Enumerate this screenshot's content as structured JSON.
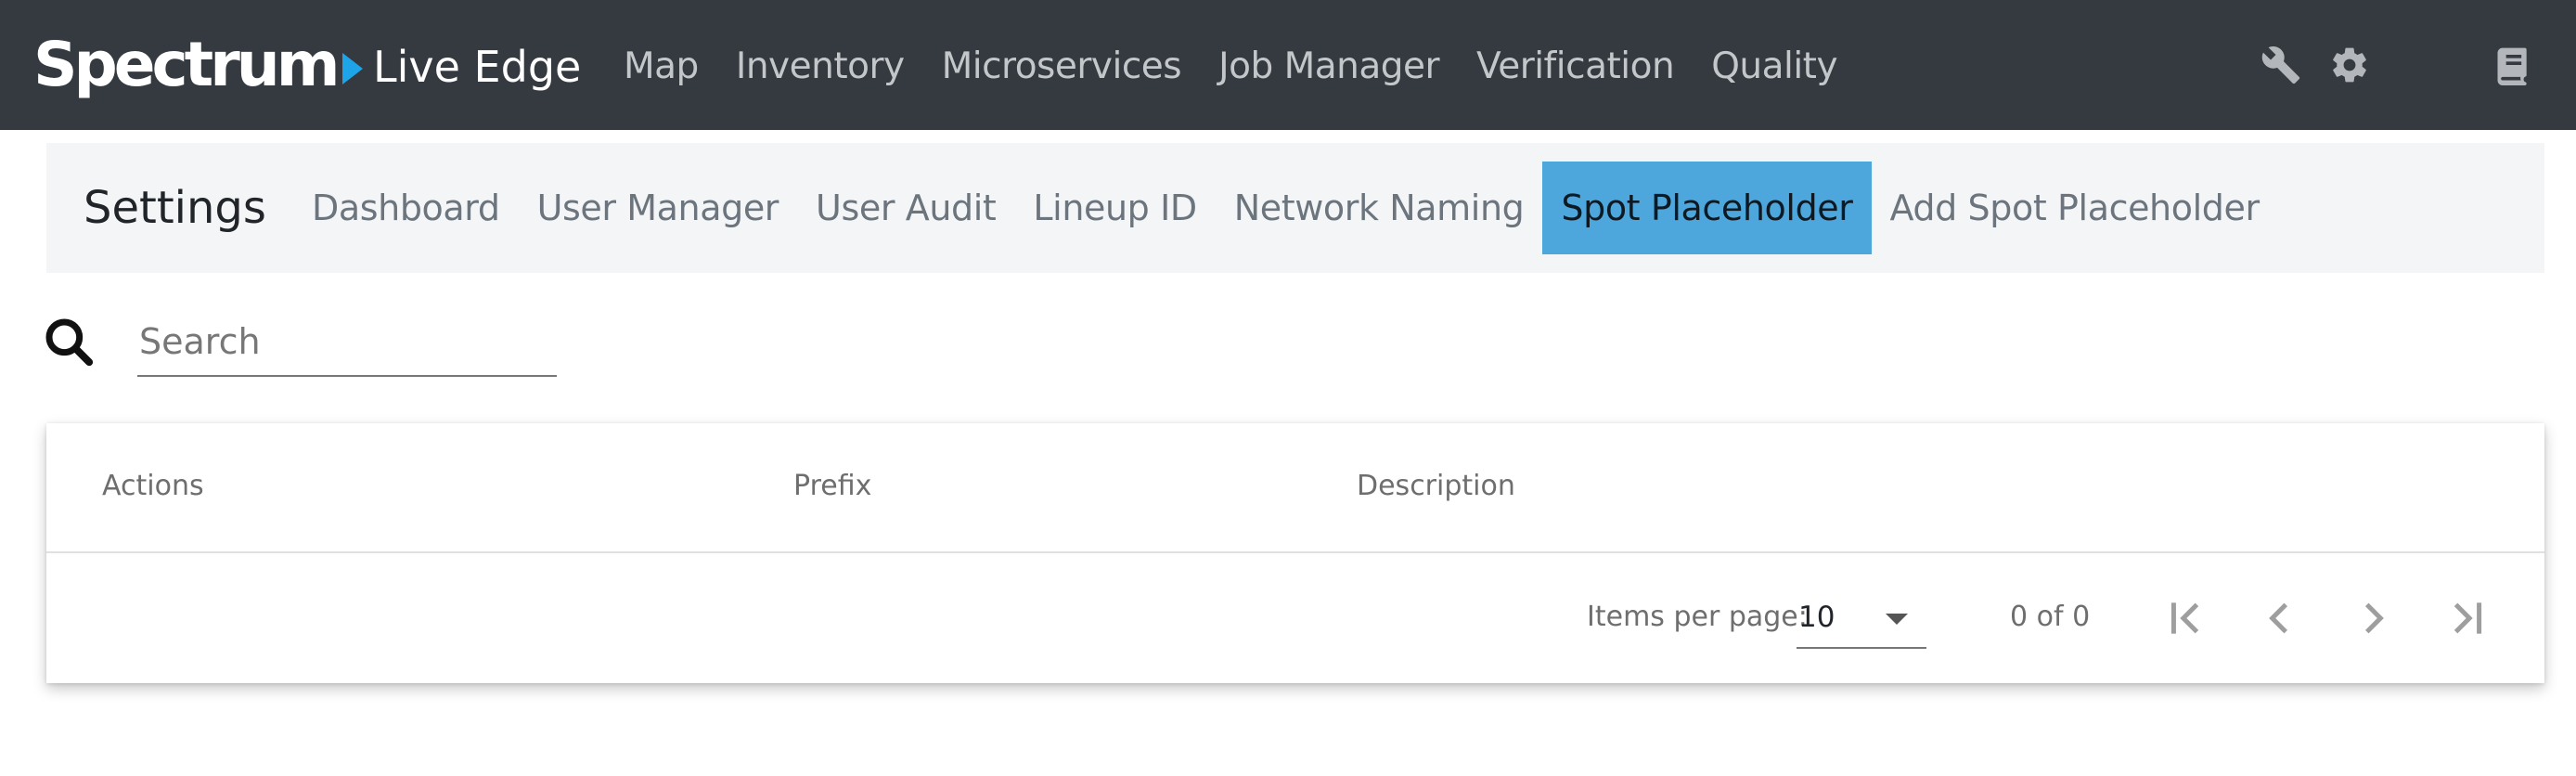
{
  "header": {
    "brand": "Spectrum",
    "app_title": "Live Edge",
    "nav": [
      "Map",
      "Inventory",
      "Microservices",
      "Job Manager",
      "Verification",
      "Quality"
    ],
    "icons": [
      "wrench-icon",
      "gear-icon",
      "book-icon"
    ],
    "colors": {
      "bar_background": "#343a40",
      "brand_arrow": "#1ea5e9"
    }
  },
  "settings": {
    "title": "Settings",
    "tabs": [
      {
        "label": "Dashboard",
        "active": false
      },
      {
        "label": "User Manager",
        "active": false
      },
      {
        "label": "User Audit",
        "active": false
      },
      {
        "label": "Lineup ID",
        "active": false
      },
      {
        "label": "Network Naming",
        "active": false
      },
      {
        "label": "Spot Placeholder",
        "active": true
      },
      {
        "label": "Add Spot Placeholder",
        "active": false
      }
    ],
    "active_color": "#4ea7dc"
  },
  "search": {
    "placeholder": "Search",
    "value": "",
    "icon": "search-icon"
  },
  "table": {
    "columns": [
      "Actions",
      "Prefix",
      "Description"
    ],
    "rows": []
  },
  "paginator": {
    "items_per_page_label": "Items per page:",
    "items_per_page": "10",
    "range_label": "0 of 0",
    "buttons": [
      "first-page-icon",
      "previous-page-icon",
      "next-page-icon",
      "last-page-icon"
    ]
  }
}
